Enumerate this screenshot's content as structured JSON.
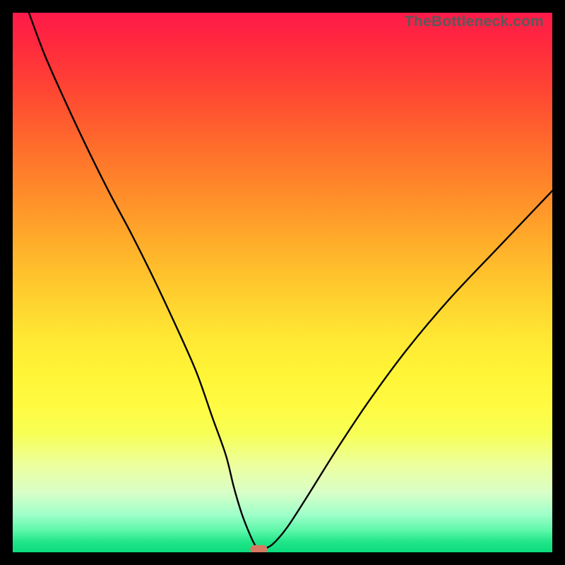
{
  "watermark": "TheBottleneck.com",
  "chart_data": {
    "type": "line",
    "title": "",
    "xlabel": "",
    "ylabel": "",
    "xlim": [
      0,
      100
    ],
    "ylim": [
      0,
      100
    ],
    "grid": false,
    "legend": false,
    "series": [
      {
        "name": "curve",
        "x": [
          3,
          6,
          10,
          14,
          18,
          22,
          26,
          30,
          34,
          37,
          39.5,
          41,
          42.5,
          44,
          45,
          45.8,
          47,
          48.5,
          51,
          55,
          60,
          66,
          73,
          81,
          90,
          100
        ],
        "values": [
          100,
          92,
          83,
          74.5,
          66.5,
          59,
          51,
          42.5,
          33.5,
          25,
          18,
          12,
          7,
          3.2,
          1.2,
          0.6,
          0.8,
          1.8,
          4.8,
          11,
          19,
          28,
          37.5,
          47,
          56.5,
          67
        ]
      }
    ],
    "marker": {
      "x": 45.6,
      "y": 0.55,
      "shape": "pill",
      "color": "#d77a61"
    }
  }
}
